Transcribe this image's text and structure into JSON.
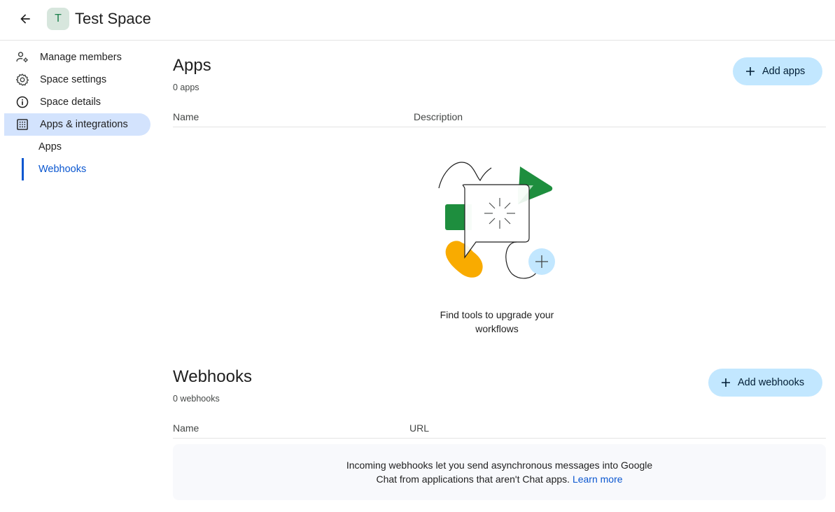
{
  "header": {
    "title": "Test Space",
    "avatar_letter": "T"
  },
  "sidebar": {
    "items": [
      {
        "label": "Manage members",
        "icon": "manage-members-icon"
      },
      {
        "label": "Space settings",
        "icon": "gear-icon"
      },
      {
        "label": "Space details",
        "icon": "info-icon"
      },
      {
        "label": "Apps & integrations",
        "icon": "apps-grid-icon",
        "active": true
      }
    ],
    "subitems": [
      {
        "label": "Apps"
      },
      {
        "label": "Webhooks",
        "selected": true
      }
    ]
  },
  "apps": {
    "title": "Apps",
    "count": "0 apps",
    "add_label": "Add apps",
    "col_name": "Name",
    "col_description": "Description",
    "empty_line1": "Find tools to upgrade your",
    "empty_line2": "workflows"
  },
  "webhooks": {
    "title": "Webhooks",
    "count": "0 webhooks",
    "add_label": "Add webhooks",
    "col_name": "Name",
    "col_url": "URL",
    "info_line1": "Incoming webhooks let you send asynchronous messages into Google",
    "info_line2": "Chat from applications that aren't Chat apps.",
    "learn_more": "Learn more"
  },
  "colors": {
    "accent": "#0b57d0",
    "active_bg": "#d3e3fd",
    "button_bg": "#c2e7ff",
    "green": "#1e8e3e",
    "yellow": "#f9ab00",
    "light_blue": "#c2e7ff"
  }
}
